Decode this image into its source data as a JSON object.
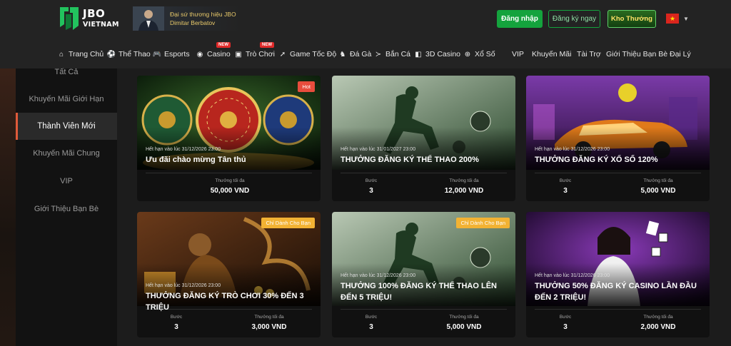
{
  "header": {
    "logo_line1": "JBO",
    "logo_line2": "VIETNAM",
    "ambassador_line1": "Đại sứ thương hiệu JBO",
    "ambassador_line2": "Dimitar Berbatov",
    "login_label": "Đăng nhập",
    "register_label": "Đăng ký ngay",
    "reward_label": "Kho Thưởng",
    "flag_icon": "vietnam-flag-icon"
  },
  "nav": {
    "items": [
      {
        "label": "Trang Chủ",
        "icon": "home-icon"
      },
      {
        "label": "Thể Thao",
        "icon": "soccer-ball-icon"
      },
      {
        "label": "Esports",
        "icon": "gamepad-icon"
      },
      {
        "label": "Casino",
        "icon": "casino-chip-icon",
        "badge": "NEW"
      },
      {
        "label": "Trò Chơi",
        "icon": "slot-machine-icon",
        "badge": "NEW"
      },
      {
        "label": "Game Tốc Độ",
        "icon": "speed-icon"
      },
      {
        "label": "Đá Gà",
        "icon": "rooster-icon"
      },
      {
        "label": "Bắn Cá",
        "icon": "fish-icon"
      },
      {
        "label": "3D Casino",
        "icon": "cube-icon"
      },
      {
        "label": "Xổ Số",
        "icon": "lottery-ball-icon"
      },
      {
        "label": "VIP"
      },
      {
        "label": "Khuyến Mãi"
      },
      {
        "label": "Tài Trợ"
      },
      {
        "label": "Giới Thiệu Bạn Bè"
      },
      {
        "label": "Đại Lý"
      }
    ]
  },
  "sidebar": {
    "items": [
      {
        "label": "Tất Cả"
      },
      {
        "label": "Khuyến Mãi Giới Hạn"
      },
      {
        "label": "Thành Viên Mới",
        "active": true
      },
      {
        "label": "Khuyến Mãi Chung"
      },
      {
        "label": "VIP"
      },
      {
        "label": "Giới Thiệu Bạn Bè"
      }
    ]
  },
  "labels": {
    "steps": "Bước",
    "max_bonus": "Thưởng tối đa"
  },
  "cards": [
    {
      "tag": "Hot",
      "expire": "Hết hạn vào lúc 31/12/2026 23:00",
      "title": "Ưu đãi chào mừng Tân thủ",
      "steps": "",
      "max_bonus": "50,000 VND"
    },
    {
      "tag": "",
      "expire": "Hết hạn vào lúc 31/01/2027 23:00",
      "title": "THƯỞNG ĐĂNG KÝ THỂ THAO 200%",
      "steps": "3",
      "max_bonus": "12,000 VND"
    },
    {
      "tag": "",
      "expire": "Hết hạn vào lúc 31/12/2026 23:00",
      "title": "THƯỞNG ĐĂNG KÝ XỔ SỐ 120%",
      "steps": "3",
      "max_bonus": "5,000 VND"
    },
    {
      "tag": "Chỉ Dành Cho Bạn",
      "expire": "Hết hạn vào lúc 31/12/2026 23:00",
      "title": "THƯỞNG ĐĂNG KÝ TRÒ CHƠI 30% ĐẾN 3 TRIỆU",
      "steps": "3",
      "max_bonus": "3,000 VND"
    },
    {
      "tag": "Chỉ Dành Cho Bạn",
      "expire": "Hết hạn vào lúc 31/12/2026 23:00",
      "title": "THƯỞNG 100% ĐĂNG KÝ THỂ THAO LÊN ĐẾN 5 TRIỆU!",
      "steps": "3",
      "max_bonus": "5,000 VND"
    },
    {
      "tag": "",
      "expire": "Hết hạn vào lúc 31/12/2026 23:00",
      "title": "THƯỞNG 50% ĐĂNG KÝ CASINO LẦN ĐẦU ĐẾN 2 TRIỆU!",
      "steps": "3",
      "max_bonus": "2,000 VND"
    }
  ],
  "colors": {
    "accent_green": "#14a33d",
    "hot_tag": "#e84d3d",
    "gold_tag": "#f2b233",
    "active_marker": "#e05a3a"
  }
}
